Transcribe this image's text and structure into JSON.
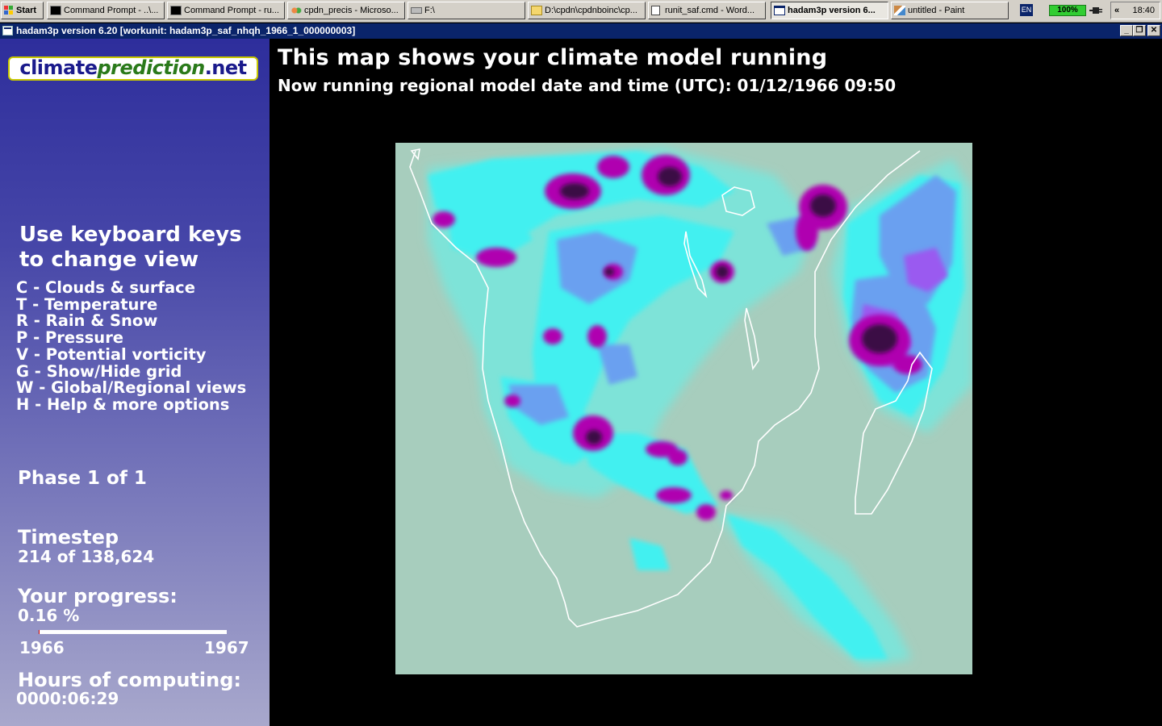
{
  "taskbar": {
    "start_label": "Start",
    "tasks": [
      "Command Prompt - ..\\...",
      "Command Prompt - ru...",
      "cpdn_precis - Microso...",
      "F:\\",
      "D:\\cpdn\\cpdnboinc\\cp...",
      "runit_saf.cmd - Word...",
      "hadam3p version 6...",
      "untitled - Paint"
    ],
    "active_task_index": 6,
    "language": "EN",
    "battery": "100%",
    "tray_arrows": "«",
    "clock": "18:40"
  },
  "window": {
    "title": "hadam3p version 6.20 [workunit: hadam3p_saf_nhqh_1966_1_000000003]",
    "buttons": {
      "minimize": "_",
      "restore": "❐",
      "close": "✕"
    }
  },
  "sidebar": {
    "logo": {
      "part1": "climate",
      "part2": "prediction",
      "part3": ".net"
    },
    "heading_line1": "Use keyboard keys",
    "heading_line2": "to change view",
    "keys": [
      "C - Clouds & surface",
      "T - Temperature",
      "R - Rain & Snow",
      "P - Pressure",
      "V - Potential vorticity",
      "G - Show/Hide grid",
      "W - Global/Regional views",
      "H - Help & more options"
    ],
    "phase": "Phase 1 of 1",
    "timestep_label": "Timestep",
    "timestep_value": "214 of 138,624",
    "progress_label": "Your progress:",
    "progress_value": "0.16 %",
    "progress_fraction": 0.0016,
    "year_start": "1966",
    "year_end": "1967",
    "hours_label": "Hours of computing:",
    "hours_value": "0000:06:29"
  },
  "main": {
    "title": "This map shows your climate model running",
    "subtitle": "Now running regional model date and time (UTC): 01/12/1966 09:50"
  },
  "colors": {
    "map_background": "#a7cdbd",
    "rain_light": "#7ee3d8",
    "rain_cyan": "#43f0f0",
    "rain_blue": "#6aa0f0",
    "rain_violet": "#9a5af0",
    "rain_magenta": "#b000b0",
    "rain_dark": "#3a0e44",
    "title_bar": "#0a246a"
  }
}
